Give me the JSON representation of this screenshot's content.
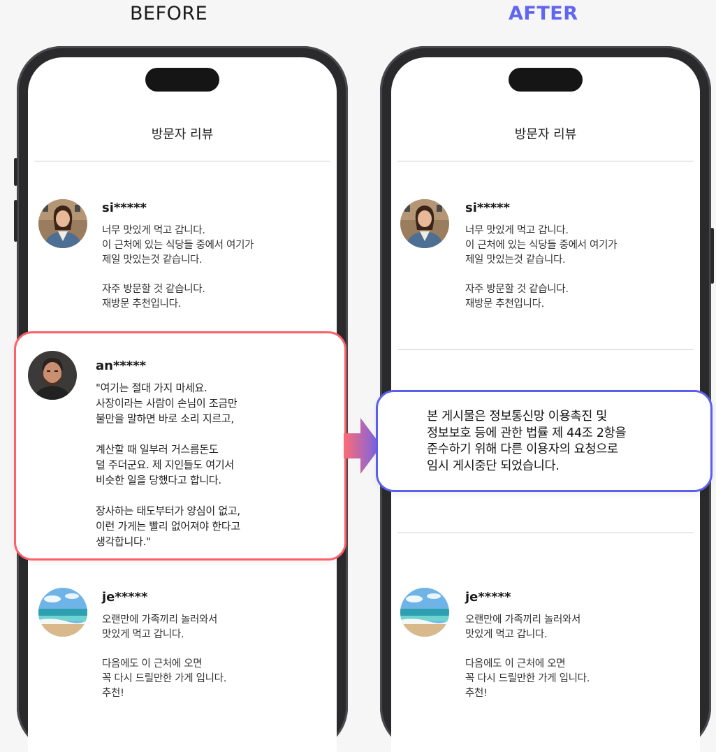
{
  "labels": {
    "before": "BEFORE",
    "after": "AFTER"
  },
  "colors": {
    "before_accent": "#ff5f68",
    "after_accent": "#5b5ff0"
  },
  "before": {
    "title": "방문자 리뷰",
    "reviews": [
      {
        "user": "si*****",
        "text": "너무 맛있게 먹고 갑니다.\n이 근처에 있는 식당들 중에서 여기가\n제일 맛있는것 같습니다.\n\n자주 방문할 것 같습니다.\n재방문 추천입니다."
      },
      {
        "user": "an*****",
        "text": "\"여기는 절대 가지 마세요.\n사장이라는 사람이 손님이 조금만\n불만을 말하면 바로 소리 지르고,\n\n계산할 때 일부러 거스름돈도\n덜 주더군요. 제 지인들도 여기서\n비슷한 일을 당했다고 합니다.\n\n장사하는 태도부터가 양심이 없고,\n이런 가게는 빨리 없어져야 한다고\n생각합니다.\""
      },
      {
        "user": "je*****",
        "text": "오랜만에 가족끼리 놀러와서\n맛있게 먹고 갑니다.\n\n다음에도 이 근처에 오면\n꼭 다시 드릴만한 가게 입니다.\n추천!"
      }
    ]
  },
  "after": {
    "title": "방문자 리뷰",
    "reviews": [
      {
        "user": "si*****",
        "text": "너무 맛있게 먹고 갑니다.\n이 근처에 있는 식당들 중에서 여기가\n제일 맛있는것 같습니다.\n\n자주 방문할 것 같습니다.\n재방문 추천입니다."
      },
      {
        "user": "je*****",
        "text": "오랜만에 가족끼리 놀러와서\n맛있게 먹고 갑니다.\n\n다음에도 이 근처에 오면\n꼭 다시 드릴만한 가게 입니다.\n추천!"
      }
    ],
    "notice": "본 게시물은 정보통신망 이용촉진 및\n정보보호 등에 관한 법률 제 44조 2항을\n준수하기 위해 다른 이용자의 요청으로\n임시 게시중단 되었습니다."
  },
  "icons": {
    "avatar_1": "woman-portrait-icon",
    "avatar_2": "man-portrait-icon",
    "avatar_3": "beach-landscape-icon",
    "transition": "right-arrow-icon"
  }
}
